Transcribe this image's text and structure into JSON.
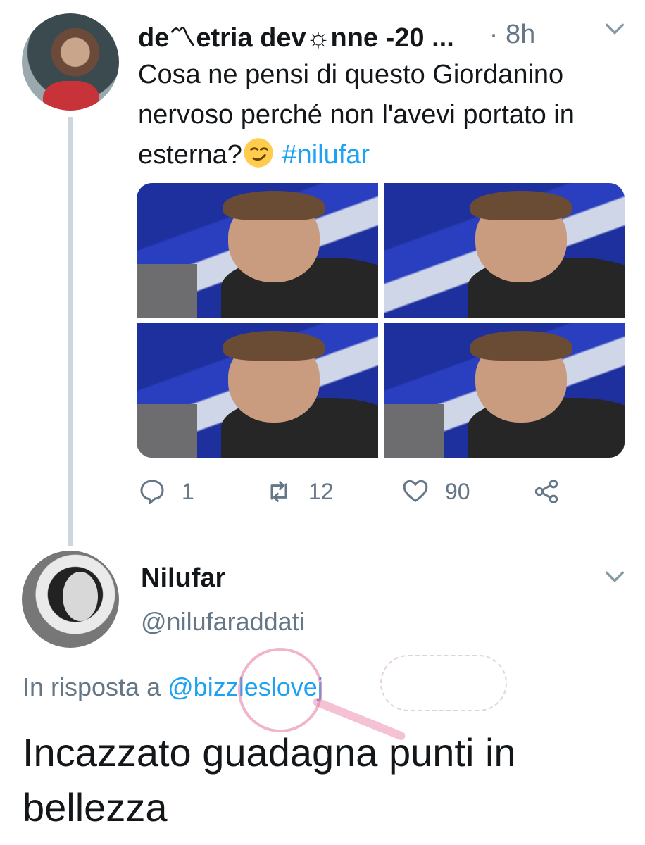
{
  "tweet": {
    "author_name": "de〽etria dev☼nne -20 ...",
    "time": "· 8h",
    "text_main": "Cosa ne pensi di questo Giordanino nervoso perché non l'avevi portato in esterna?",
    "hashtag": "#nilufar",
    "actions": {
      "replies": "1",
      "retweets": "12",
      "likes": "90"
    },
    "icons": [
      "reply-icon",
      "retweet-icon",
      "like-icon",
      "share-icon",
      "chevron-down-icon",
      "smirk-emoji"
    ]
  },
  "reply": {
    "author_name": "Nilufar",
    "handle": "@nilufaraddati",
    "in_reply_prefix": "In risposta a",
    "in_reply_mention": "@bizzleslovej",
    "text": "Incazzato guadagna punti in bellezza"
  },
  "colors": {
    "link": "#1da1f2",
    "secondary": "#657786",
    "primary_text": "#14171a",
    "thread_line": "#ccd6dd"
  }
}
